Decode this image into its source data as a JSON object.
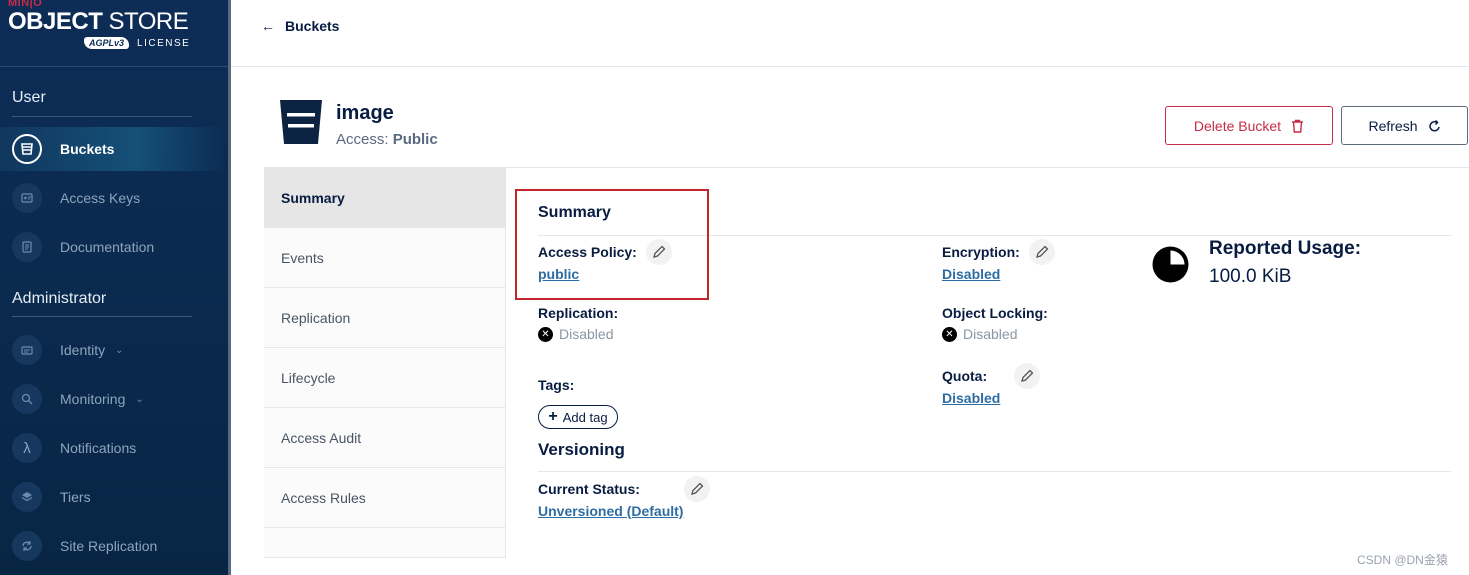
{
  "logo": {
    "brand": "MIN|O",
    "product_bold": "OBJECT",
    "product_thin": "STORE",
    "badge": "AGPLv3",
    "license": "LICENSE"
  },
  "sidebar": {
    "sections": [
      {
        "title": "User"
      },
      {
        "title": "Administrator"
      }
    ],
    "items": [
      {
        "label": "Buckets",
        "icon": "bucket-icon",
        "active": true
      },
      {
        "label": "Access Keys",
        "icon": "key-icon"
      },
      {
        "label": "Documentation",
        "icon": "document-icon"
      },
      {
        "label": "Identity",
        "icon": "identity-icon",
        "expandable": true
      },
      {
        "label": "Monitoring",
        "icon": "monitoring-icon",
        "expandable": true
      },
      {
        "label": "Notifications",
        "icon": "lambda-icon"
      },
      {
        "label": "Tiers",
        "icon": "layers-icon"
      },
      {
        "label": "Site Replication",
        "icon": "replication-icon"
      }
    ]
  },
  "topbar": {
    "back_label": "Buckets"
  },
  "bucket": {
    "name": "image",
    "access_label": "Access:",
    "access_value": "Public"
  },
  "actions": {
    "delete_label": "Delete Bucket",
    "refresh_label": "Refresh"
  },
  "tabs": [
    {
      "label": "Summary",
      "active": true
    },
    {
      "label": "Events"
    },
    {
      "label": "Replication"
    },
    {
      "label": "Lifecycle"
    },
    {
      "label": "Access Audit"
    },
    {
      "label": "Access Rules"
    }
  ],
  "summary": {
    "title": "Summary",
    "access_policy_label": "Access Policy:",
    "access_policy_value": "public",
    "encryption_label": "Encryption:",
    "encryption_value": "Disabled",
    "replication_label": "Replication:",
    "replication_value": "Disabled",
    "object_locking_label": "Object Locking:",
    "object_locking_value": "Disabled",
    "tags_label": "Tags:",
    "add_tag_label": "Add tag",
    "quota_label": "Quota:",
    "quota_value": "Disabled",
    "usage_title": "Reported Usage:",
    "usage_value": "100.0 KiB"
  },
  "versioning": {
    "title": "Versioning",
    "current_status_label": "Current Status:",
    "current_status_value": "Unversioned (Default)"
  },
  "colors": {
    "sidebar_bg": "#0d2d57",
    "danger": "#c72c48",
    "link": "#2e6da4",
    "highlight_box": "#c1272d"
  },
  "watermark": "CSDN @DN金猿"
}
